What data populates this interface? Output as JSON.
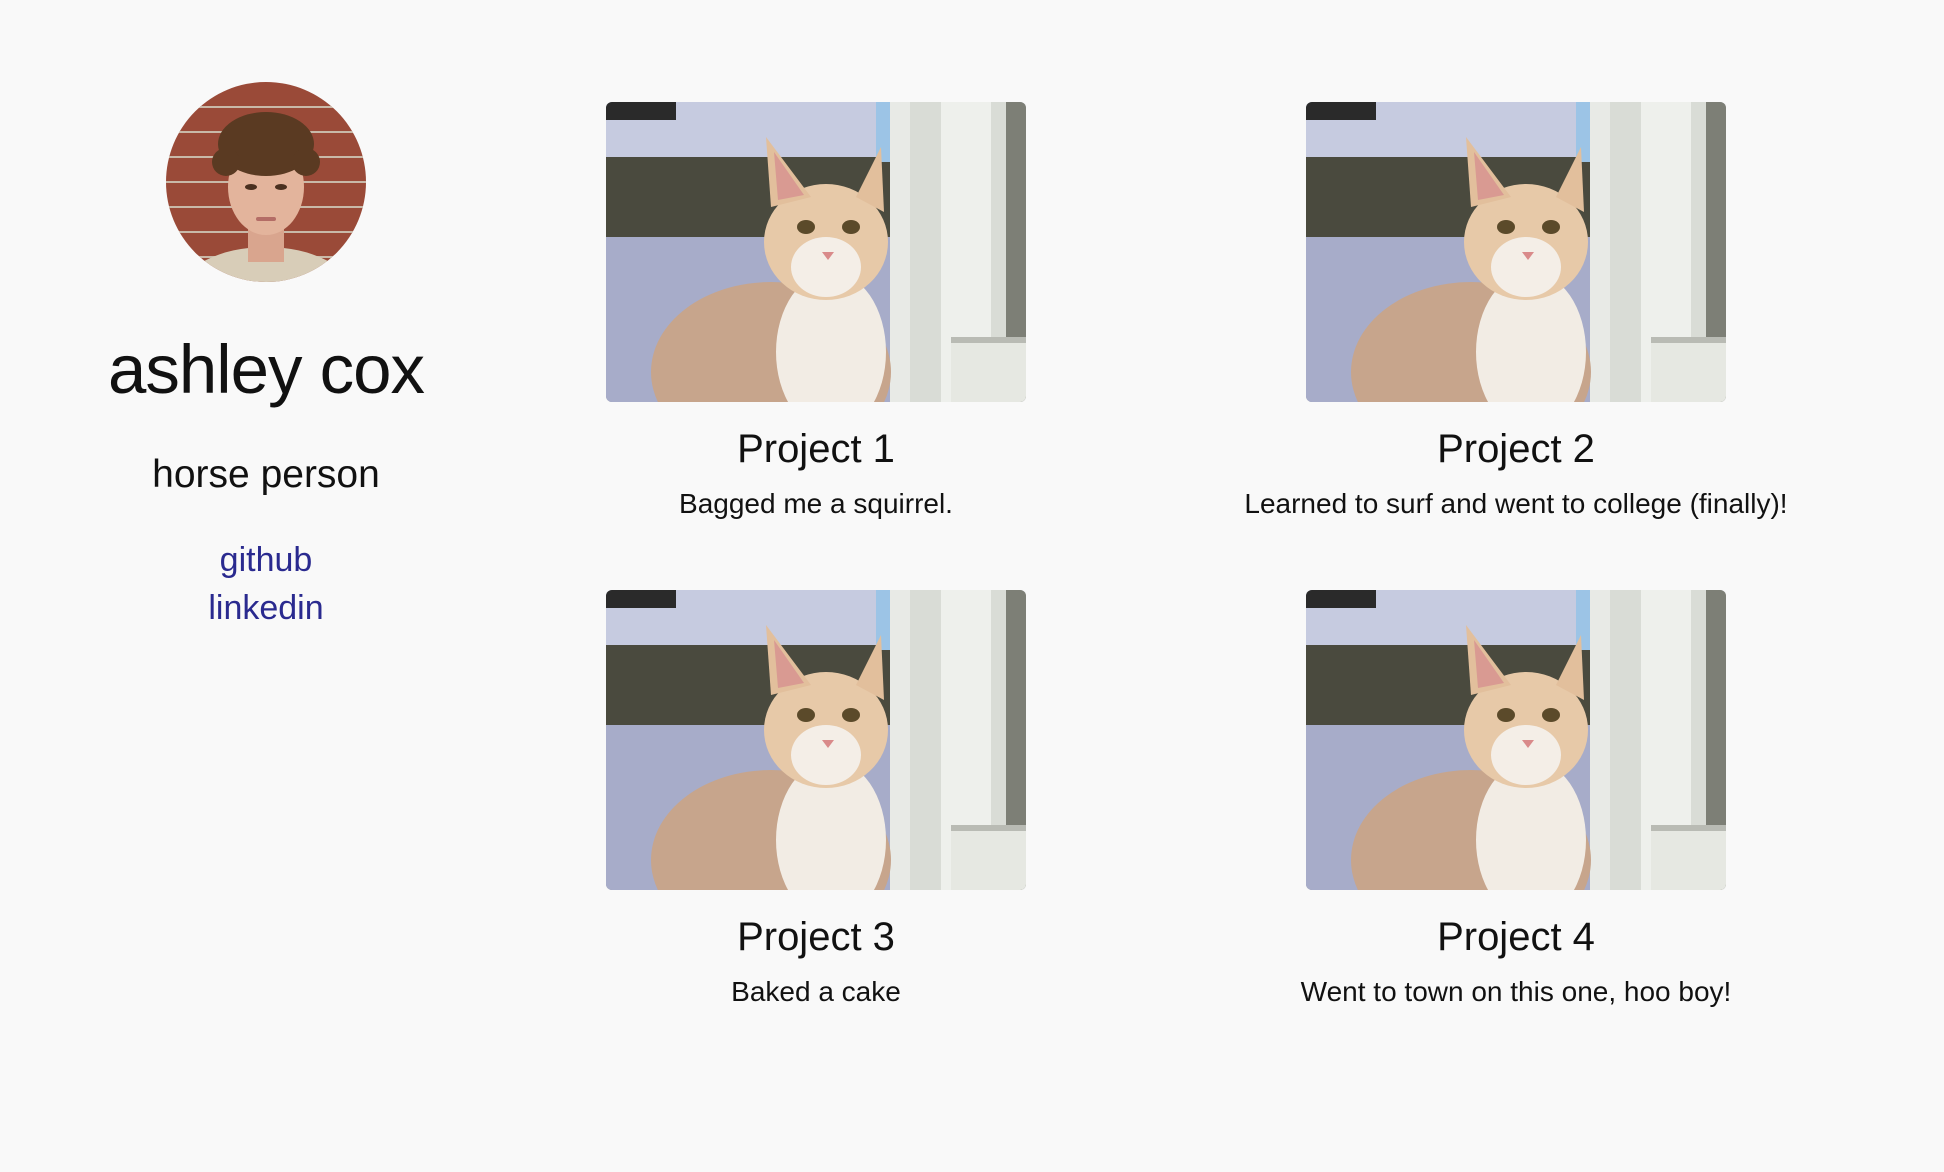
{
  "profile": {
    "name": "ashley cox",
    "tagline": "horse person",
    "links": [
      {
        "label": "github"
      },
      {
        "label": "linkedin"
      }
    ]
  },
  "projects": [
    {
      "title": "Project 1",
      "description": "Bagged me a squirrel."
    },
    {
      "title": "Project 2",
      "description": "Learned to surf and went to college (finally)!"
    },
    {
      "title": "Project 3",
      "description": "Baked a cake"
    },
    {
      "title": "Project 4",
      "description": "Went to town on this one, hoo boy!"
    }
  ],
  "colors": {
    "background": "#f9f9f9",
    "link": "#2a2a8f",
    "text": "#111111"
  }
}
